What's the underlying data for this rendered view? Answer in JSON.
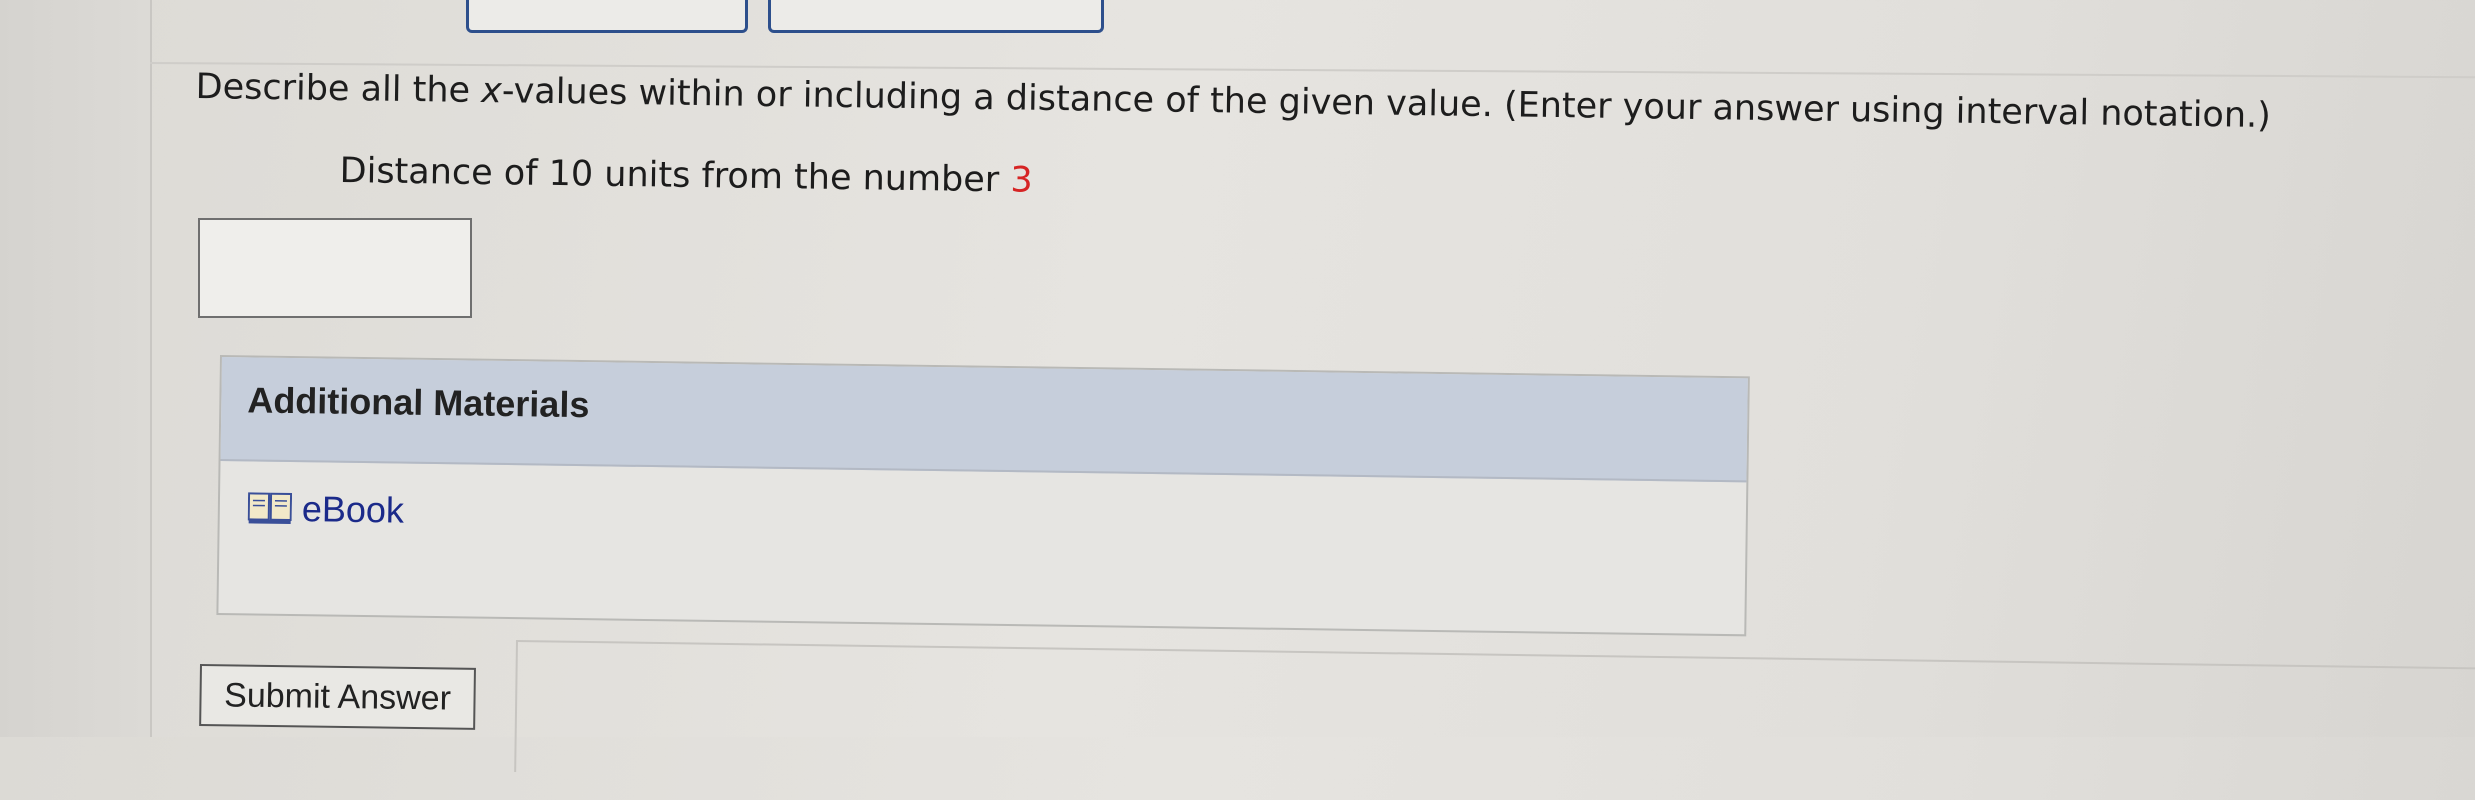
{
  "question": {
    "text_before": "Describe all the ",
    "variable": "x",
    "text_after": "-values within or including a distance of the given value. (Enter your answer using interval notation.)"
  },
  "prompt": {
    "text": "Distance of 10 units from the number ",
    "number": "3"
  },
  "answer": {
    "value": ""
  },
  "materials": {
    "title": "Additional Materials",
    "ebook_label": "eBook"
  },
  "submit": {
    "label": "Submit Answer"
  },
  "colors": {
    "accent_red": "#d62424",
    "link_blue": "#1b2a8a",
    "header_blue": "#c6cedb"
  }
}
